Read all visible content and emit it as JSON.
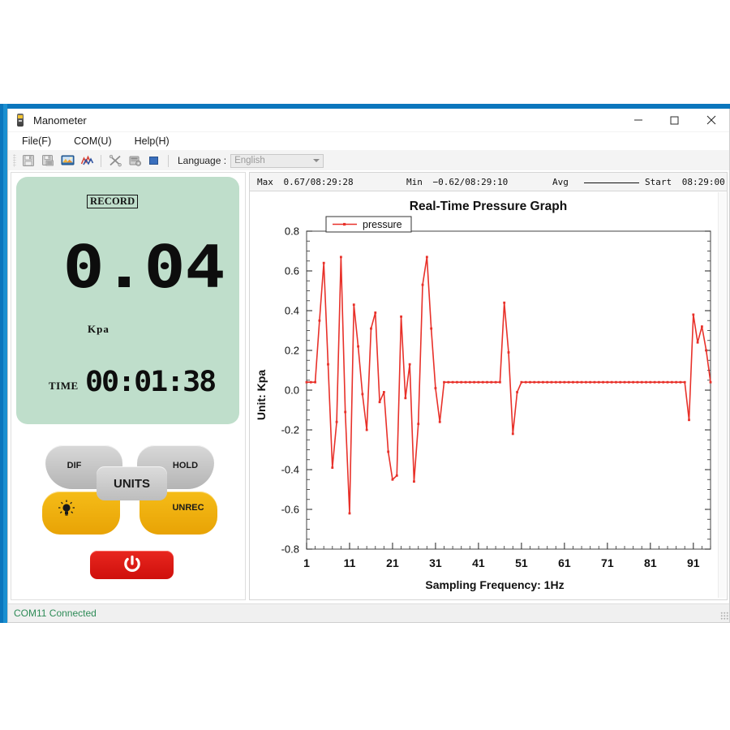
{
  "window": {
    "title": "Manometer",
    "icon": "device-icon",
    "controls": {
      "minimize": "─",
      "maximize": "□",
      "close": "✕"
    }
  },
  "menu": {
    "items": [
      {
        "name": "file",
        "label": "File(F)"
      },
      {
        "name": "com",
        "label": "COM(U)"
      },
      {
        "name": "help",
        "label": "Help(H)"
      }
    ]
  },
  "toolbar": {
    "buttons": [
      {
        "name": "save-icon",
        "glyph": "save"
      },
      {
        "name": "save-as-icon",
        "glyph": "save-as"
      },
      {
        "name": "export-image-icon",
        "glyph": "image"
      },
      {
        "name": "chart-icon",
        "glyph": "chart"
      },
      {
        "name": "tools-icon",
        "glyph": "tools"
      },
      {
        "name": "settings-icon",
        "glyph": "settings"
      },
      {
        "name": "stop-icon",
        "glyph": "stop"
      }
    ],
    "language_label": "Language :",
    "language_value": "English",
    "language_options": [
      "English"
    ]
  },
  "device": {
    "record_badge": "RECORD",
    "value": "0.04",
    "unit": "Kpa",
    "time_label": "TIME",
    "time_value": "00:01:38",
    "lcd_color": "#bfdecb",
    "keys": [
      {
        "name": "dif-button",
        "label": "DIF"
      },
      {
        "name": "hold-button",
        "label": "HOLD"
      },
      {
        "name": "units-button",
        "label": "UNITS"
      },
      {
        "name": "backlight-button",
        "label": ""
      },
      {
        "name": "unrec-button",
        "label": "UNREC"
      },
      {
        "name": "power-button",
        "label": ""
      }
    ]
  },
  "stats": {
    "max_label": "Max",
    "max_value": "0.67/08:29:28",
    "min_label": "Min",
    "min_value": "−0.62/08:29:10",
    "avg_label": "Avg",
    "avg_value": "",
    "start_label": "Start",
    "start_value": "08:29:00"
  },
  "status": {
    "text": "COM11 Connected",
    "color": "#2e8b57"
  },
  "chart_data": {
    "type": "line",
    "title": "Real-Time Pressure Graph",
    "xlabel": "Sampling Frequency: 1Hz",
    "ylabel": "Unit: Kpa",
    "legend": [
      "pressure"
    ],
    "legend_position": "top-left",
    "series_color": "#e8312a",
    "grid": false,
    "ylim": [
      -0.8,
      0.8
    ],
    "yticks": [
      -0.8,
      -0.6,
      -0.4,
      -0.2,
      0.0,
      0.2,
      0.4,
      0.6,
      0.8
    ],
    "ytick_labels": [
      "-0.8",
      "-0.6",
      "-0.4",
      "-0.2",
      "0.0",
      "0.2",
      "0.4",
      "0.6",
      "0.8"
    ],
    "xlim": [
      1,
      95
    ],
    "xticks": [
      1,
      11,
      21,
      31,
      41,
      51,
      61,
      71,
      81,
      91
    ],
    "xtick_labels": [
      "1",
      "11",
      "21",
      "31",
      "41",
      "51",
      "61",
      "71",
      "81",
      "91"
    ],
    "x": [
      1,
      2,
      3,
      4,
      5,
      6,
      7,
      8,
      9,
      10,
      11,
      12,
      13,
      14,
      15,
      16,
      17,
      18,
      19,
      20,
      21,
      22,
      23,
      24,
      25,
      26,
      27,
      28,
      29,
      30,
      31,
      32,
      33,
      34,
      35,
      36,
      37,
      38,
      39,
      40,
      41,
      42,
      43,
      44,
      45,
      46,
      47,
      48,
      49,
      50,
      51,
      52,
      53,
      54,
      55,
      56,
      57,
      58,
      59,
      60,
      61,
      62,
      63,
      64,
      65,
      66,
      67,
      68,
      69,
      70,
      71,
      72,
      73,
      74,
      75,
      76,
      77,
      78,
      79,
      80,
      81,
      82,
      83,
      84,
      85,
      86,
      87,
      88,
      89,
      90,
      91,
      92,
      93,
      94,
      95
    ],
    "values": [
      0.04,
      0.04,
      0.04,
      0.35,
      0.64,
      0.13,
      -0.39,
      -0.16,
      0.67,
      -0.11,
      -0.62,
      0.43,
      0.22,
      -0.02,
      -0.2,
      0.31,
      0.39,
      -0.06,
      -0.01,
      -0.31,
      -0.45,
      -0.43,
      0.37,
      -0.04,
      0.13,
      -0.46,
      -0.17,
      0.53,
      0.67,
      0.31,
      0.01,
      -0.16,
      0.04,
      0.04,
      0.04,
      0.04,
      0.04,
      0.04,
      0.04,
      0.04,
      0.04,
      0.04,
      0.04,
      0.04,
      0.04,
      0.04,
      0.44,
      0.19,
      -0.22,
      -0.01,
      0.04,
      0.04,
      0.04,
      0.04,
      0.04,
      0.04,
      0.04,
      0.04,
      0.04,
      0.04,
      0.04,
      0.04,
      0.04,
      0.04,
      0.04,
      0.04,
      0.04,
      0.04,
      0.04,
      0.04,
      0.04,
      0.04,
      0.04,
      0.04,
      0.04,
      0.04,
      0.04,
      0.04,
      0.04,
      0.04,
      0.04,
      0.04,
      0.04,
      0.04,
      0.04,
      0.04,
      0.04,
      0.04,
      0.04,
      -0.15,
      0.38,
      0.24,
      0.32,
      0.2,
      0.04
    ]
  }
}
